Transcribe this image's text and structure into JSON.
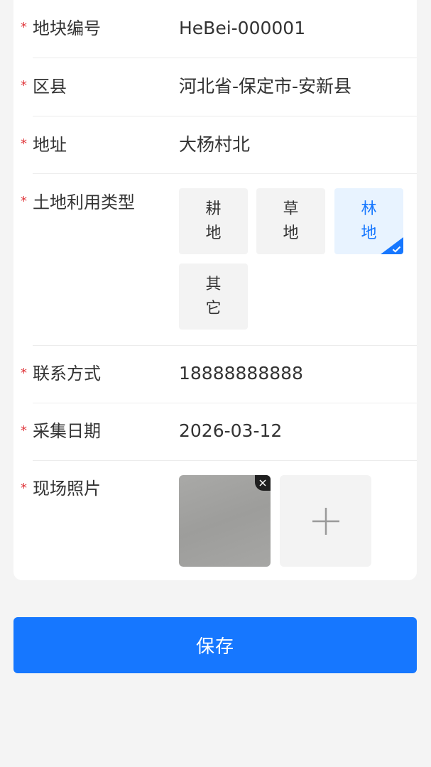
{
  "form": {
    "fields": [
      {
        "label": "地块编号",
        "value": "HeBei-000001"
      },
      {
        "label": "区县",
        "value": "河北省-保定市-安新县"
      },
      {
        "label": "地址",
        "value": "大杨村北"
      },
      {
        "label": "土地利用类型"
      },
      {
        "label": "联系方式",
        "value": "18888888888"
      },
      {
        "label": "采集日期",
        "value": "2026-03-12"
      },
      {
        "label": "现场照片"
      }
    ],
    "required_mark": "*",
    "land_types": [
      {
        "label": "耕地",
        "selected": false
      },
      {
        "label": "草地",
        "selected": false
      },
      {
        "label": "林地",
        "selected": true
      },
      {
        "label": "其它",
        "selected": false
      }
    ]
  },
  "actions": {
    "save_label": "保存"
  },
  "colors": {
    "accent": "#1677ff",
    "required": "#e0393e",
    "selected_bg": "#e8f3ff",
    "page_bg": "#f4f4f4"
  },
  "icons": {
    "check": "check-icon",
    "close": "close-icon",
    "add": "plus-icon"
  }
}
